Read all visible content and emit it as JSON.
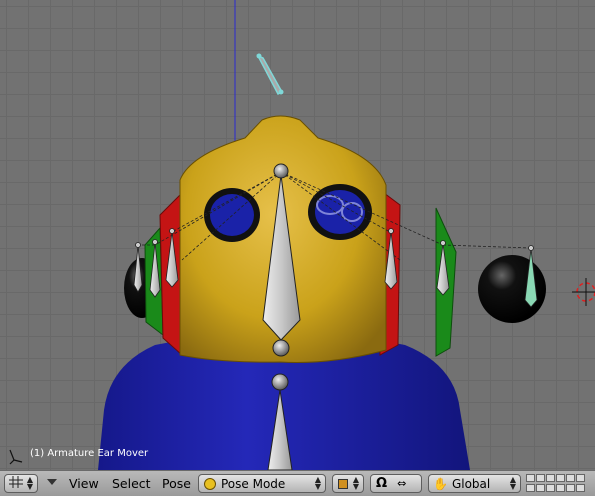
{
  "viewport": {
    "status_text": "(1) Armature Ear Mover"
  },
  "header": {
    "view_menu": "View",
    "select_menu": "Select",
    "pose_menu": "Pose",
    "mode_select": "Pose Mode",
    "orientation_select": "Global"
  },
  "icons": {
    "viewtype": "grid-icon",
    "mode": "pose-mode-icon",
    "pivot": "pivot-icon",
    "manipulator": "magnet-icon",
    "transform": "transform-icon",
    "hand": "hand-icon"
  },
  "colors": {
    "helmet_yellow": "#d4aa1a",
    "eye_blue": "#1a22a8",
    "body_blue": "#1c1fa6",
    "ear_red": "#c41414",
    "ear_green": "#1a8a1a",
    "selected_bone": "#7fd8d8",
    "ear_bone": "#8ad8b4"
  }
}
